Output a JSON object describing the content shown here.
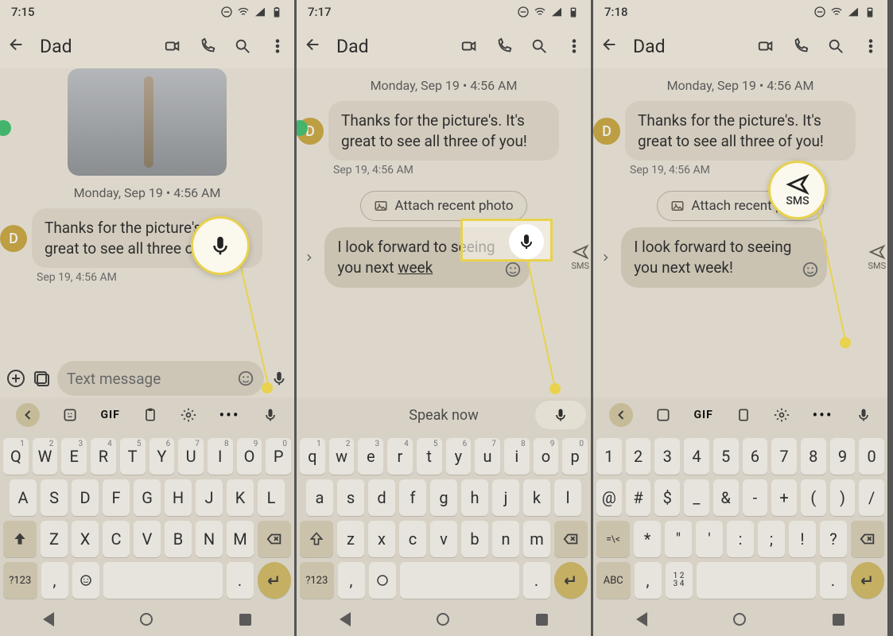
{
  "screens": [
    {
      "time": "7:15",
      "contact": "Dad",
      "date_label": "Monday, Sep 19 • 4:56 AM",
      "avatar_letter": "D",
      "msg_text": "Thanks for the picture's. It's great to see all three of you!",
      "msg_time": "Sep 19, 4:56 AM",
      "compose_placeholder": "Text message",
      "kbd_toolbar_gif": "GIF",
      "keys_r1": [
        "Q",
        "W",
        "E",
        "R",
        "T",
        "Y",
        "U",
        "I",
        "O",
        "P"
      ],
      "keys_r1_sup": [
        "1",
        "2",
        "3",
        "4",
        "5",
        "6",
        "7",
        "8",
        "9",
        "0"
      ],
      "keys_r2": [
        "A",
        "S",
        "D",
        "F",
        "G",
        "H",
        "J",
        "K",
        "L"
      ],
      "keys_r3": [
        "Z",
        "X",
        "C",
        "V",
        "B",
        "N",
        "M"
      ],
      "sym_key": "?123",
      "callout_label": ""
    },
    {
      "time": "7:17",
      "contact": "Dad",
      "date_label": "Monday, Sep 19 • 4:56 AM",
      "avatar_letter": "D",
      "msg_text": "Thanks for the picture's. It's great to see all three of you!",
      "msg_time": "Sep 19, 4:56 AM",
      "attach_chip": "Attach recent photo",
      "compose_text_a": "I look forward to seeing you next ",
      "compose_text_b": "week",
      "send_label": "SMS",
      "speak_now": "Speak now",
      "keys_r1": [
        "q",
        "w",
        "e",
        "r",
        "t",
        "y",
        "u",
        "i",
        "o",
        "p"
      ],
      "keys_r1_sup": [
        "1",
        "2",
        "3",
        "4",
        "5",
        "6",
        "7",
        "8",
        "9",
        "0"
      ],
      "keys_r2": [
        "a",
        "s",
        "d",
        "f",
        "g",
        "h",
        "j",
        "k",
        "l"
      ],
      "keys_r3": [
        "z",
        "x",
        "c",
        "v",
        "b",
        "n",
        "m"
      ],
      "sym_key": "?123"
    },
    {
      "time": "7:18",
      "contact": "Dad",
      "date_label": "Monday, Sep 19 • 4:56 AM",
      "avatar_letter": "D",
      "msg_text": "Thanks for the picture's. It's great to see all three of you!",
      "msg_time": "Sep 19, 4:56 AM",
      "attach_chip": "Attach recent photo",
      "compose_text": "I look forward to seeing you next week!",
      "send_label": "SMS",
      "kbd_toolbar_gif": "GIF",
      "keys_r1": [
        "1",
        "2",
        "3",
        "4",
        "5",
        "6",
        "7",
        "8",
        "9",
        "0"
      ],
      "keys_r2": [
        "@",
        "#",
        "$",
        "_",
        "&",
        "-",
        "+",
        "(",
        ")",
        "/"
      ],
      "keys_r3": [
        "*",
        "\"",
        "'",
        ":",
        ";",
        "!",
        "?"
      ],
      "sym_shift": "=\\<",
      "sym_key": "ABC",
      "num_key": "1 2\n3 4",
      "callout_label": "SMS"
    }
  ]
}
